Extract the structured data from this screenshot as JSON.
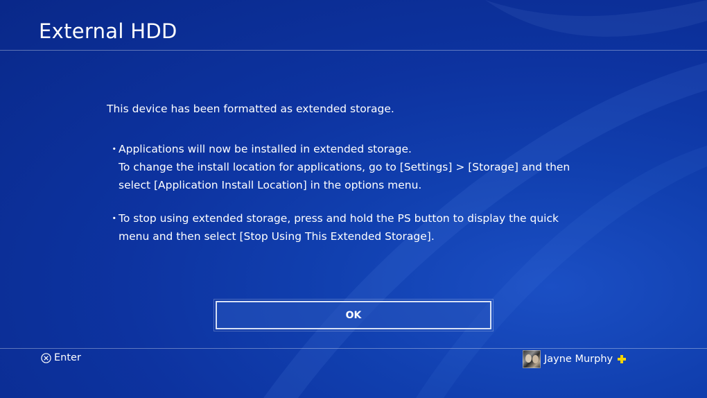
{
  "header": {
    "title": "External HDD"
  },
  "dialog": {
    "intro": "This device has been formatted as extended storage.",
    "bullet_char": "・",
    "bullets": [
      {
        "lines": [
          "Applications will now be installed in extended storage.",
          "To change the install location for applications, go to [Settings] > [Storage] and then",
          "select [Application Install Location] in the options menu."
        ]
      },
      {
        "lines": [
          "To stop using extended storage, press and hold the PS button to display the quick",
          "menu and then select [Stop Using This Extended Storage]."
        ]
      }
    ],
    "ok_label": "OK"
  },
  "footer": {
    "enter_icon": "cross-button-icon",
    "enter_label": "Enter",
    "user_name": "Jayne Murphy",
    "plus_icon": "playstation-plus-icon",
    "plus_color": "#f5d400"
  },
  "colors": {
    "background": "#0d33a0",
    "text": "#ffffff"
  }
}
